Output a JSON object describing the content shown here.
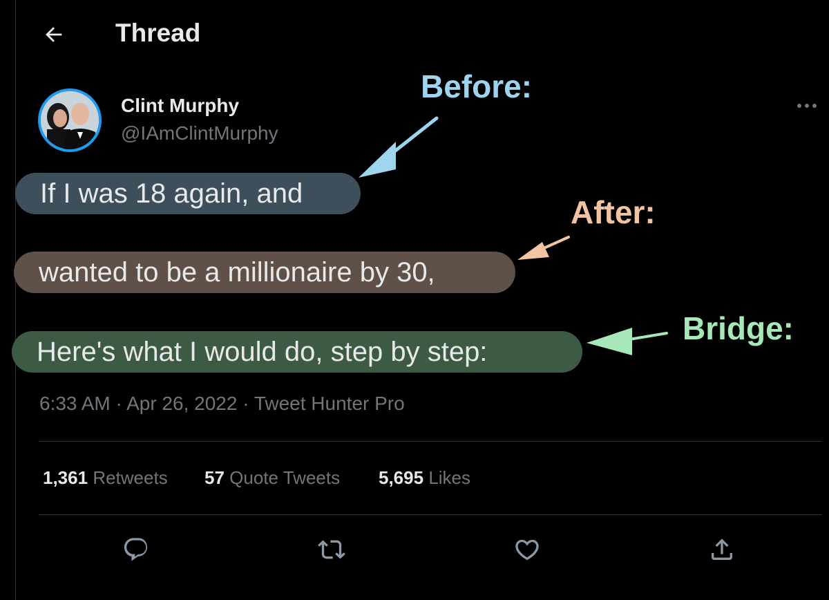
{
  "header": {
    "title": "Thread",
    "back_icon": "arrow-left-icon"
  },
  "author": {
    "name": "Clint Murphy",
    "handle": "@IAmClintMurphy",
    "avatar_ring_color": "#1d9bf0"
  },
  "tweet": {
    "lines": [
      "If I was 18 again, and",
      "wanted to be a millionaire by 30,",
      "Here's what I would do, step by step:"
    ],
    "time": "6:33 AM",
    "date": "Apr 26, 2022",
    "source": "Tweet Hunter Pro",
    "separator": "·"
  },
  "annotations": {
    "before": "Before:",
    "after": "After:",
    "bridge": "Bridge:",
    "colors": {
      "before": "#9fd4ee",
      "after": "#f2c4a3",
      "bridge": "#a7e8b8"
    }
  },
  "stats": {
    "retweets_count": "1,361",
    "retweets_label": "Retweets",
    "quotes_count": "57",
    "quotes_label": "Quote Tweets",
    "likes_count": "5,695",
    "likes_label": "Likes"
  },
  "actions": [
    "reply-icon",
    "retweet-icon",
    "like-icon",
    "share-icon"
  ],
  "colors": {
    "background": "#000000",
    "text": "#e7e9ea",
    "muted": "#71767b",
    "divider": "#2f3336"
  }
}
